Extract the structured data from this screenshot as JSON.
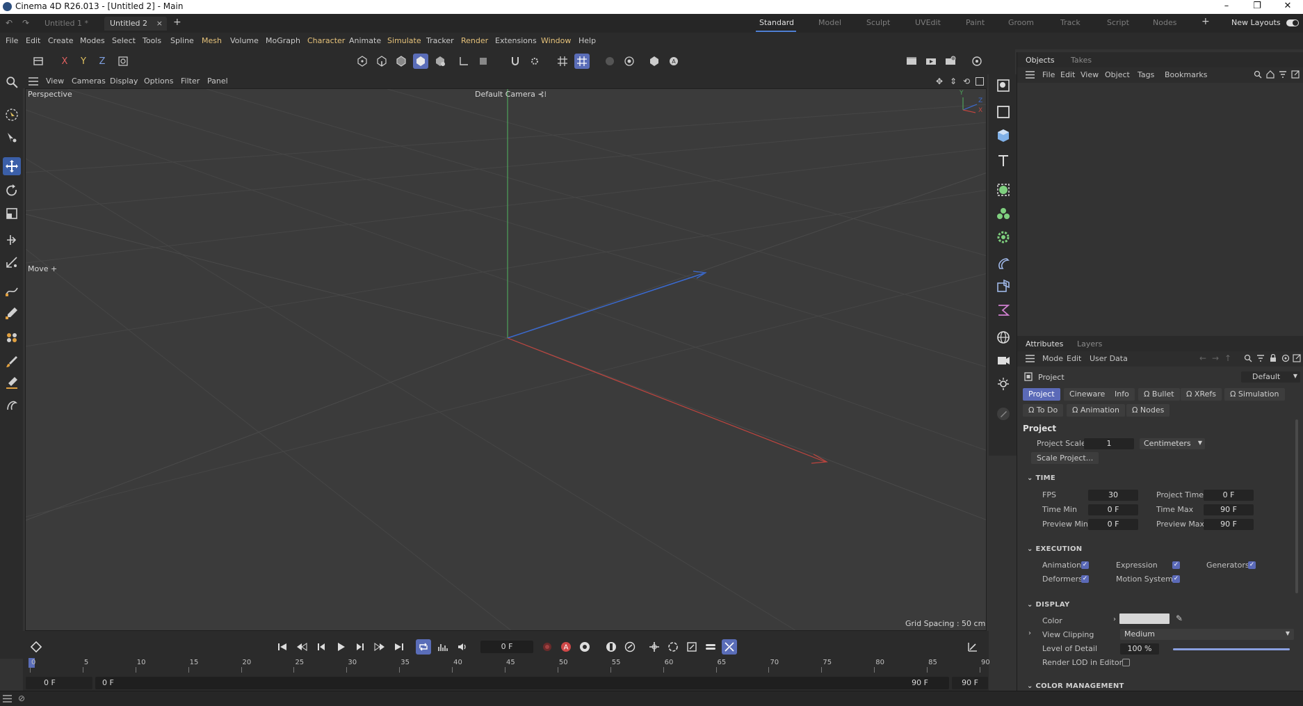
{
  "window": {
    "title": "Cinema 4D R26.013 - [Untitled 2] - Main",
    "minimize": "–",
    "restore": "❐",
    "close": "✕"
  },
  "doc_tabs": [
    "Untitled 1 *",
    "Untitled 2"
  ],
  "doc_tab_close": "×",
  "doc_tab_add": "+",
  "layouts": [
    "Standard",
    "Model",
    "Sculpt",
    "UVEdit",
    "Paint",
    "Groom",
    "Track",
    "Script",
    "Nodes"
  ],
  "layout_add": "+",
  "new_layouts": "New Layouts",
  "menu": [
    "File",
    "Edit",
    "Create",
    "Modes",
    "Select",
    "Tools",
    "Spline",
    "Mesh",
    "Volume",
    "MoGraph",
    "Character",
    "Animate",
    "Simulate",
    "Tracker",
    "Render",
    "Extensions",
    "Window",
    "Help"
  ],
  "toolbar_axes": {
    "x": "X",
    "y": "Y",
    "z": "Z"
  },
  "viewport_menu": [
    "View",
    "Cameras",
    "Display",
    "Options",
    "Filter",
    "Panel"
  ],
  "viewport": {
    "projection": "Perspective",
    "camera": "Default Camera",
    "camera_suffix": "⊰⁞",
    "tool_hint": "Move",
    "tool_hint_icon": "+",
    "grid_spacing": "Grid Spacing : 50 cm",
    "axis_y": "Y",
    "axis_z": "Z",
    "axis_x": "X"
  },
  "objects_panel": {
    "tabs": [
      "Objects",
      "Takes"
    ],
    "menu": [
      "File",
      "Edit",
      "View",
      "Object",
      "Tags",
      "Bookmarks"
    ]
  },
  "attributes_panel": {
    "tabs": [
      "Attributes",
      "Layers"
    ],
    "menu": [
      "Mode",
      "Edit",
      "User Data"
    ],
    "object": "Project",
    "preset": "Default",
    "chips_row1": [
      "Project",
      "Cineware",
      "Info",
      "Bullet",
      "XRefs",
      "Simulation"
    ],
    "chips_row2": [
      "To Do",
      "Animation",
      "Nodes"
    ],
    "section_title": "Project",
    "project_scale_label": "Project Scale",
    "project_scale_value": "1",
    "project_scale_unit": "Centimeters",
    "scale_project_button": "Scale Project...",
    "time_header": "TIME",
    "fps_label": "FPS",
    "fps": "30",
    "project_time_label": "Project Time",
    "project_time": "0 F",
    "time_min_label": "Time Min",
    "time_min": "0 F",
    "time_max_label": "Time Max",
    "time_max": "90 F",
    "preview_min_label": "Preview Min",
    "preview_min": "0 F",
    "preview_max_label": "Preview Max",
    "preview_max": "90 F",
    "execution_header": "EXECUTION",
    "animation_label": "Animation",
    "expression_label": "Expression",
    "generators_label": "Generators",
    "deformers_label": "Deformers",
    "motion_system_label": "Motion System",
    "display_header": "DISPLAY",
    "color_label": "Color",
    "color_value": "#d8d8d8",
    "view_clipping_label": "View Clipping",
    "view_clipping_value": "Medium",
    "lod_label": "Level of Detail",
    "lod_value": "100 %",
    "lod_fraction": 1.0,
    "render_lod_label": "Render LOD in Editor",
    "color_mgmt_header": "COLOR MANAGEMENT"
  },
  "timeline": {
    "current_frame": "0 F",
    "ruler": [
      "0",
      "5",
      "10",
      "15",
      "20",
      "25",
      "30",
      "35",
      "40",
      "45",
      "50",
      "55",
      "60",
      "65",
      "70",
      "75",
      "80",
      "85",
      "90"
    ],
    "start_field": "0 F",
    "preview_start_field": "0 F",
    "preview_end_field": "90 F",
    "end_field": "90 F",
    "auto_key_label": "A"
  },
  "colors": {
    "accent": "#5a6db8",
    "axis_x": "#c0453f",
    "axis_y": "#4ea25a",
    "axis_z": "#3a6ad0",
    "menu_highlight": "#e6c27a"
  }
}
